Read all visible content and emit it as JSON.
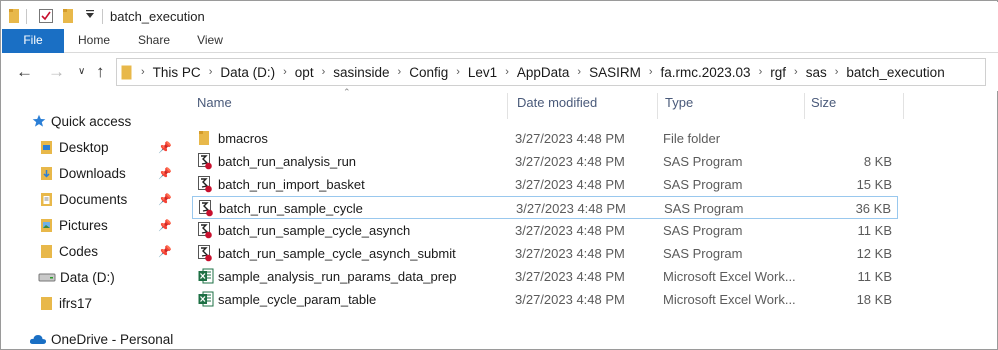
{
  "window": {
    "title": "batch_execution"
  },
  "ribbon": {
    "tabs": [
      "File",
      "Home",
      "Share",
      "View"
    ]
  },
  "address": {
    "crumbs": [
      "This PC",
      "Data (D:)",
      "opt",
      "sasinside",
      "Config",
      "Lev1",
      "AppData",
      "SASIRM",
      "fa.rmc.2023.03",
      "rgf",
      "sas",
      "batch_execution"
    ]
  },
  "nav": {
    "quick_access": "Quick access",
    "items": [
      {
        "label": "Desktop",
        "icon": "desktop-folder-icon",
        "pinned": true
      },
      {
        "label": "Downloads",
        "icon": "downloads-folder-icon",
        "pinned": true
      },
      {
        "label": "Documents",
        "icon": "documents-folder-icon",
        "pinned": true
      },
      {
        "label": "Pictures",
        "icon": "pictures-folder-icon",
        "pinned": true
      },
      {
        "label": "Codes",
        "icon": "folder-icon",
        "pinned": true
      },
      {
        "label": "Data (D:)",
        "icon": "drive-icon",
        "pinned": false
      },
      {
        "label": "ifrs17",
        "icon": "folder-icon",
        "pinned": false
      }
    ],
    "onedrive": "OneDrive - Personal"
  },
  "columns": {
    "name": "Name",
    "date": "Date modified",
    "type": "Type",
    "size": "Size"
  },
  "files": [
    {
      "name": "bmacros",
      "date": "3/27/2023 4:48 PM",
      "type": "File folder",
      "size": "",
      "icon": "folder"
    },
    {
      "name": "batch_run_analysis_run",
      "date": "3/27/2023 4:48 PM",
      "type": "SAS Program",
      "size": "8 KB",
      "icon": "sas"
    },
    {
      "name": "batch_run_import_basket",
      "date": "3/27/2023 4:48 PM",
      "type": "SAS Program",
      "size": "15 KB",
      "icon": "sas"
    },
    {
      "name": "batch_run_sample_cycle",
      "date": "3/27/2023 4:48 PM",
      "type": "SAS Program",
      "size": "36 KB",
      "icon": "sas",
      "selected": true
    },
    {
      "name": "batch_run_sample_cycle_asynch",
      "date": "3/27/2023 4:48 PM",
      "type": "SAS Program",
      "size": "11 KB",
      "icon": "sas"
    },
    {
      "name": "batch_run_sample_cycle_asynch_submit",
      "date": "3/27/2023 4:48 PM",
      "type": "SAS Program",
      "size": "12 KB",
      "icon": "sas"
    },
    {
      "name": "sample_analysis_run_params_data_prep",
      "date": "3/27/2023 4:48 PM",
      "type": "Microsoft Excel Work...",
      "size": "11 KB",
      "icon": "excel"
    },
    {
      "name": "sample_cycle_param_table",
      "date": "3/27/2023 4:48 PM",
      "type": "Microsoft Excel Work...",
      "size": "18 KB",
      "icon": "excel"
    }
  ],
  "colors": {
    "accent": "#1a6fc4",
    "folder": "#e8b84a",
    "selection": "#99c8ee",
    "excel": "#1d7044",
    "sas_dot": "#c8102e"
  }
}
